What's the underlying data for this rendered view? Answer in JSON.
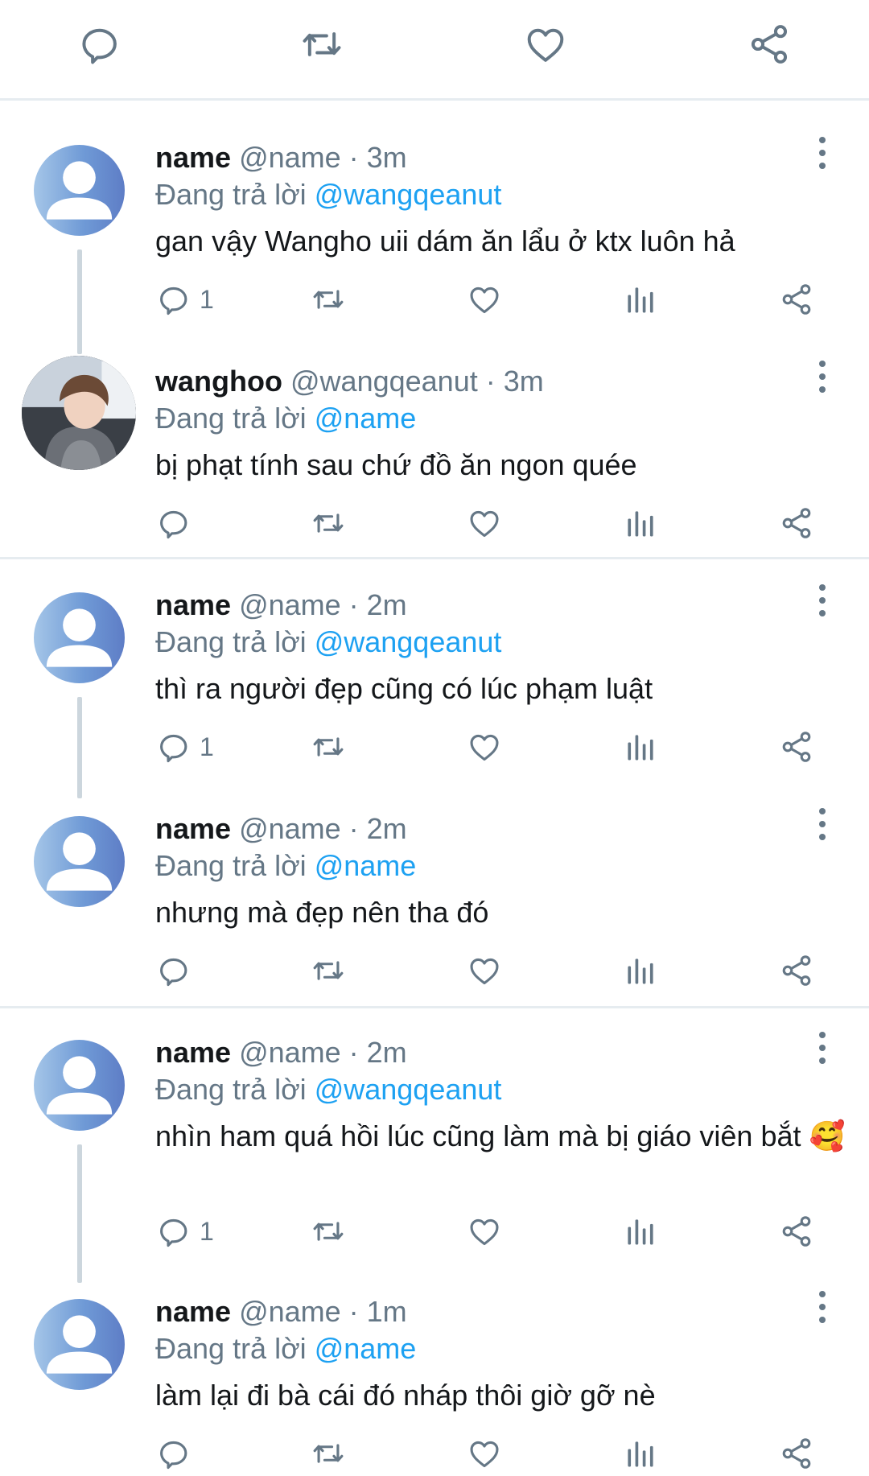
{
  "top_actions": [
    {
      "icon": "reply-icon"
    },
    {
      "icon": "retweet-icon"
    },
    {
      "icon": "like-icon"
    },
    {
      "icon": "share-icon"
    }
  ],
  "colors": {
    "accent": "#1da1f2",
    "muted": "#657786",
    "text": "#14171a",
    "divider": "#e6ecf0"
  },
  "tweets": [
    {
      "name": "name",
      "meta": "@name · 3m",
      "reply_prefix": "Đang trả lời",
      "mention": "@wangqeanut",
      "text": "gan vậy Wangho uii dám ăn lẩu ở ktx luôn hả",
      "reply_count": "1"
    },
    {
      "name": "wanghoo",
      "meta": "@wangqeanut · 3m",
      "reply_prefix": "Đang trả lời",
      "mention": "@name",
      "text": "bị phạt tính sau chứ đồ ăn ngon quée",
      "reply_count": ""
    },
    {
      "name": "name",
      "meta": "@name · 2m",
      "reply_prefix": "Đang trả lời",
      "mention": "@wangqeanut",
      "text": "thì ra người đẹp cũng có lúc phạm luật",
      "reply_count": "1"
    },
    {
      "name": "name",
      "meta": "@name · 2m",
      "reply_prefix": "Đang trả lời",
      "mention": "@name",
      "text": "nhưng mà đẹp nên tha đó",
      "reply_count": ""
    },
    {
      "name": "name",
      "meta": "@name · 2m",
      "reply_prefix": "Đang trả lời",
      "mention": "@wangqeanut",
      "text": "nhìn ham quá hồi lúc cũng làm mà bị giáo viên bắt 🥰",
      "reply_count": "1"
    },
    {
      "name": "name",
      "meta": "@name · 1m",
      "reply_prefix": "Đang trả lời",
      "mention": "@name",
      "text": "làm lại đi bà cái đó nháp thôi giờ gỡ nè",
      "reply_count": ""
    }
  ]
}
